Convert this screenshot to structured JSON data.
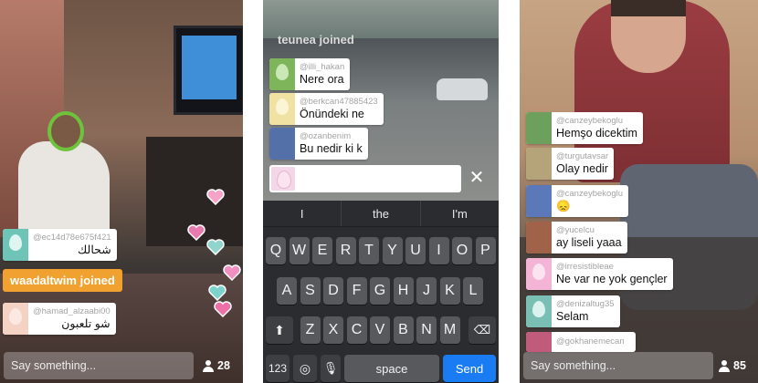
{
  "colors": {
    "joined_badge": "#f1a12f",
    "send_button": "#1a7cf2"
  },
  "left_panel": {
    "messages": [
      {
        "user": "@ec14d78e675f421",
        "text": "شحالك",
        "avatar_color": "#6fc4b8"
      },
      {
        "user": "@hamad_alzaabi00",
        "text": "شو تلعبون",
        "avatar_color": "#f4d2c4"
      }
    ],
    "joined_text": "waadaltwim joined",
    "say_placeholder": "Say something...",
    "viewer_count": "28"
  },
  "middle_panel": {
    "joined_text": "teunea joined",
    "messages": [
      {
        "user": "@illi_hakan",
        "text": "Nere ora",
        "avatar_color": "#7fb55a"
      },
      {
        "user": "@berkcan47885423",
        "text": "Önündeki ne",
        "avatar_color": "#efe2a3"
      },
      {
        "user": "@ozanbenim",
        "text": "Bu nedir ki k",
        "avatar_color": "#5470a8"
      }
    ],
    "suggestions": [
      "I",
      "the",
      "I'm"
    ],
    "keyboard": {
      "row1": [
        "Q",
        "W",
        "E",
        "R",
        "T",
        "Y",
        "U",
        "I",
        "O",
        "P"
      ],
      "row2": [
        "A",
        "S",
        "D",
        "F",
        "G",
        "H",
        "J",
        "K",
        "L"
      ],
      "row3": [
        "Z",
        "X",
        "C",
        "V",
        "B",
        "N",
        "M"
      ],
      "numbers_label": "123",
      "space_label": "space",
      "send_label": "Send"
    }
  },
  "right_panel": {
    "messages": [
      {
        "user": "@canzeybekoglu",
        "text": "Hemşo dicektim",
        "avatar_color": "#6ca05c"
      },
      {
        "user": "@turgutavsar",
        "text": "Olay nedir",
        "avatar_color": "#b5a47a"
      },
      {
        "user": "@canzeybekoglu",
        "text": "😞",
        "avatar_color": "#5b79b8"
      },
      {
        "user": "@yucelcu",
        "text": "ay liseli yaaa",
        "avatar_color": "#a06248"
      },
      {
        "user": "@irresistibleae",
        "text": "Ne var ne yok gençler",
        "avatar_color": "#f3b4d6"
      },
      {
        "user": "@denizaltug35",
        "text": "Selam",
        "avatar_color": "#79bfb3"
      },
      {
        "user": "@gokhanemecan",
        "text": "",
        "avatar_color": "#c05b7c"
      }
    ],
    "say_placeholder": "Say something...",
    "viewer_count": "85"
  }
}
